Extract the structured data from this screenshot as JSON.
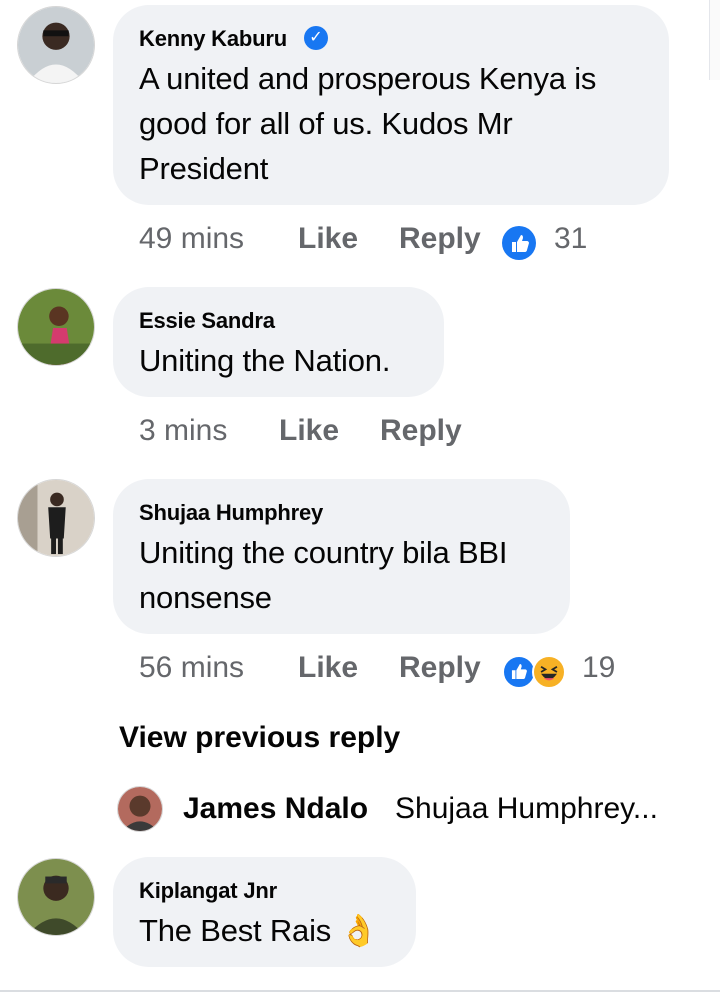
{
  "comments": [
    {
      "author": "Kenny Kaburu",
      "verified": true,
      "text_lines": [
        "A united and prosperous Kenya is",
        "good for all of us. Kudos Mr",
        "President"
      ],
      "time": "49 mins",
      "like_label": "Like",
      "reply_label": "Reply",
      "reactions": [
        "like"
      ],
      "reaction_count": "31"
    },
    {
      "author": "Essie Sandra",
      "text_lines": [
        "Uniting the Nation."
      ],
      "time": "3 mins",
      "like_label": "Like",
      "reply_label": "Reply"
    },
    {
      "author": "Shujaa Humphrey",
      "text_lines": [
        "Uniting the country bila BBI",
        "nonsense"
      ],
      "time": "56 mins",
      "like_label": "Like",
      "reply_label": "Reply",
      "reactions": [
        "like",
        "haha"
      ],
      "reaction_count": "19"
    },
    {
      "author": "Kiplangat Jnr",
      "text": "The Best Rais",
      "emoji": "👌"
    }
  ],
  "view_previous_reply": "View previous reply",
  "reply_preview": {
    "author": "James Ndalo",
    "text": "Shujaa Humphrey..."
  },
  "colors": {
    "bubble": "#f0f2f5",
    "meta": "#65676b",
    "like_blue": "#1877f2",
    "haha_yellow": "#f7b125"
  }
}
